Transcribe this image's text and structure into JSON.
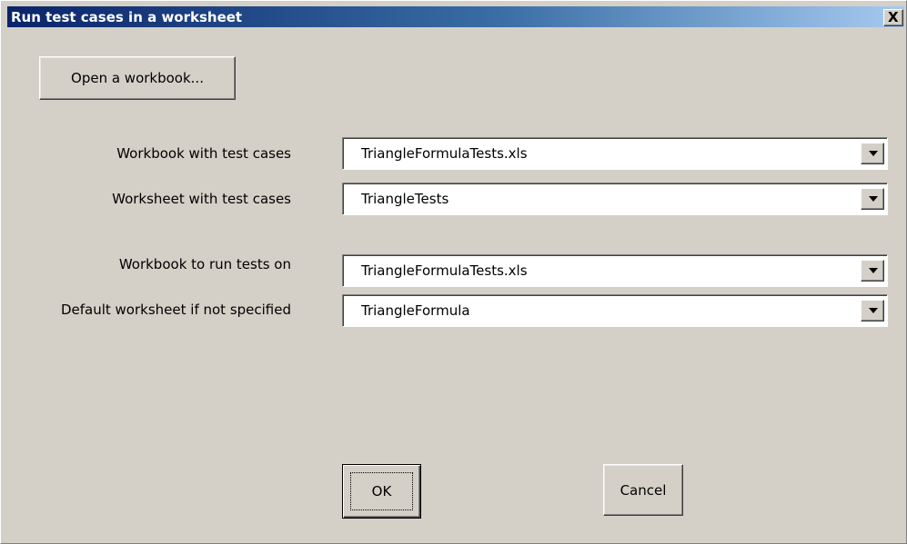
{
  "window": {
    "title": "Run test cases in a worksheet",
    "close_glyph": "X"
  },
  "buttons": {
    "open_workbook": "Open a workbook...",
    "ok": "OK",
    "cancel": "Cancel"
  },
  "fields": [
    {
      "label": "Workbook with test cases",
      "value": "TriangleFormulaTests.xls"
    },
    {
      "label": "Worksheet with test cases",
      "value": "TriangleTests"
    },
    {
      "label": "Workbook to run tests on",
      "value": "TriangleFormulaTests.xls"
    },
    {
      "label": "Default worksheet if not specified",
      "value": "TriangleFormula"
    }
  ],
  "icons": {
    "close": "close-icon",
    "dropdown": "chevron-down-icon"
  },
  "colors": {
    "titlebar_start": "#0a246a",
    "titlebar_end": "#a6caf0",
    "dialog_face": "#d4d0c8"
  }
}
